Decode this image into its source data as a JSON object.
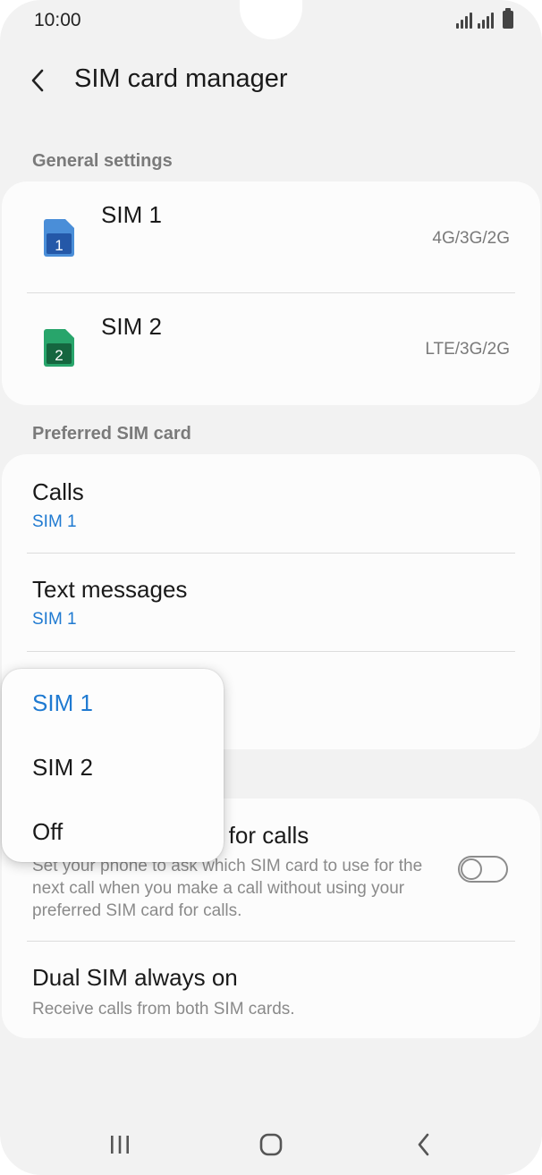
{
  "status_bar": {
    "time": "10:00"
  },
  "header": {
    "title": "SIM card manager"
  },
  "general_settings": {
    "label": "General settings",
    "sims": [
      {
        "name": "SIM 1",
        "number": "1",
        "network": "4G/3G/2G",
        "color": "#2f6fc0"
      },
      {
        "name": "SIM 2",
        "number": "2",
        "network": "LTE/3G/2G",
        "color": "#1e8c5a"
      }
    ]
  },
  "preferred_sim": {
    "label": "Preferred SIM card",
    "calls": {
      "title": "Calls",
      "value": "SIM 1"
    },
    "text_messages": {
      "title": "Text messages",
      "value": "SIM 1"
    }
  },
  "popup": {
    "options": [
      "SIM 1",
      "SIM 2",
      "Off"
    ],
    "selected": "SIM 1"
  },
  "more_settings": {
    "confirm_sim": {
      "title_visible": "d for calls",
      "description": "Set your phone to ask which SIM card to use for the next call when you make a call without using your preferred SIM card for calls.",
      "enabled": false
    },
    "dual_sim": {
      "title": "Dual SIM always on",
      "description": "Receive calls from both SIM cards."
    }
  },
  "colors": {
    "accent": "#1f7ad1",
    "background": "#f2f2f2",
    "card": "#fcfcfc"
  }
}
